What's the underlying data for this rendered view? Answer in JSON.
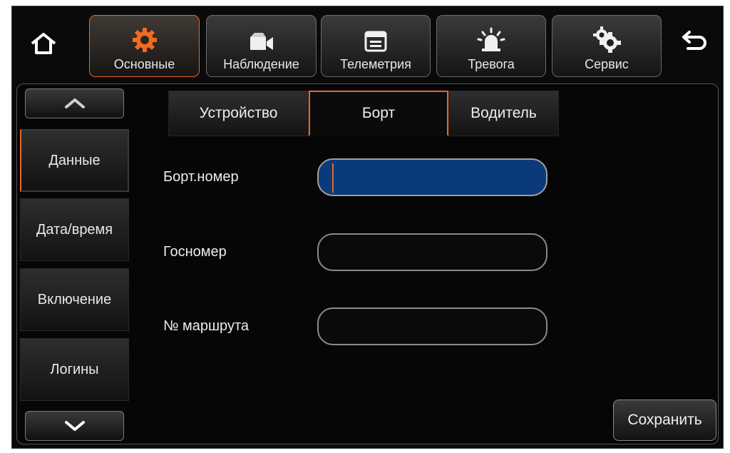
{
  "topbar": {
    "home_icon": "home-icon",
    "back_icon": "back-arrow-icon",
    "tabs": [
      {
        "label": "Основные",
        "icon": "gear-icon",
        "active": true
      },
      {
        "label": "Наблюдение",
        "icon": "camera-icon",
        "active": false
      },
      {
        "label": "Телеметрия",
        "icon": "window-icon",
        "active": false
      },
      {
        "label": "Тревога",
        "icon": "alarm-beacon-icon",
        "active": false
      },
      {
        "label": "Сервис",
        "icon": "gears-icon",
        "active": false
      }
    ]
  },
  "sidebar": {
    "up_icon": "chevron-up-icon",
    "down_icon": "chevron-down-icon",
    "items": [
      {
        "label": "Данные",
        "active": true
      },
      {
        "label": "Дата/время",
        "active": false
      },
      {
        "label": "Включение",
        "active": false
      },
      {
        "label": "Логины",
        "active": false
      }
    ]
  },
  "subtabs": [
    {
      "label": "Устройство",
      "active": false
    },
    {
      "label": "Борт",
      "active": true
    },
    {
      "label": "Водитель",
      "active": false
    }
  ],
  "form": {
    "fields": [
      {
        "label": "Борт.номер",
        "value": "",
        "focused": true
      },
      {
        "label": "Госномер",
        "value": "",
        "focused": false
      },
      {
        "label": "№ маршрута",
        "value": "",
        "focused": false
      }
    ],
    "save_label": "Сохранить"
  },
  "colors": {
    "accent": "#e8682a",
    "focus_fill": "#0a3a7a",
    "background": "#0a0a0a"
  }
}
